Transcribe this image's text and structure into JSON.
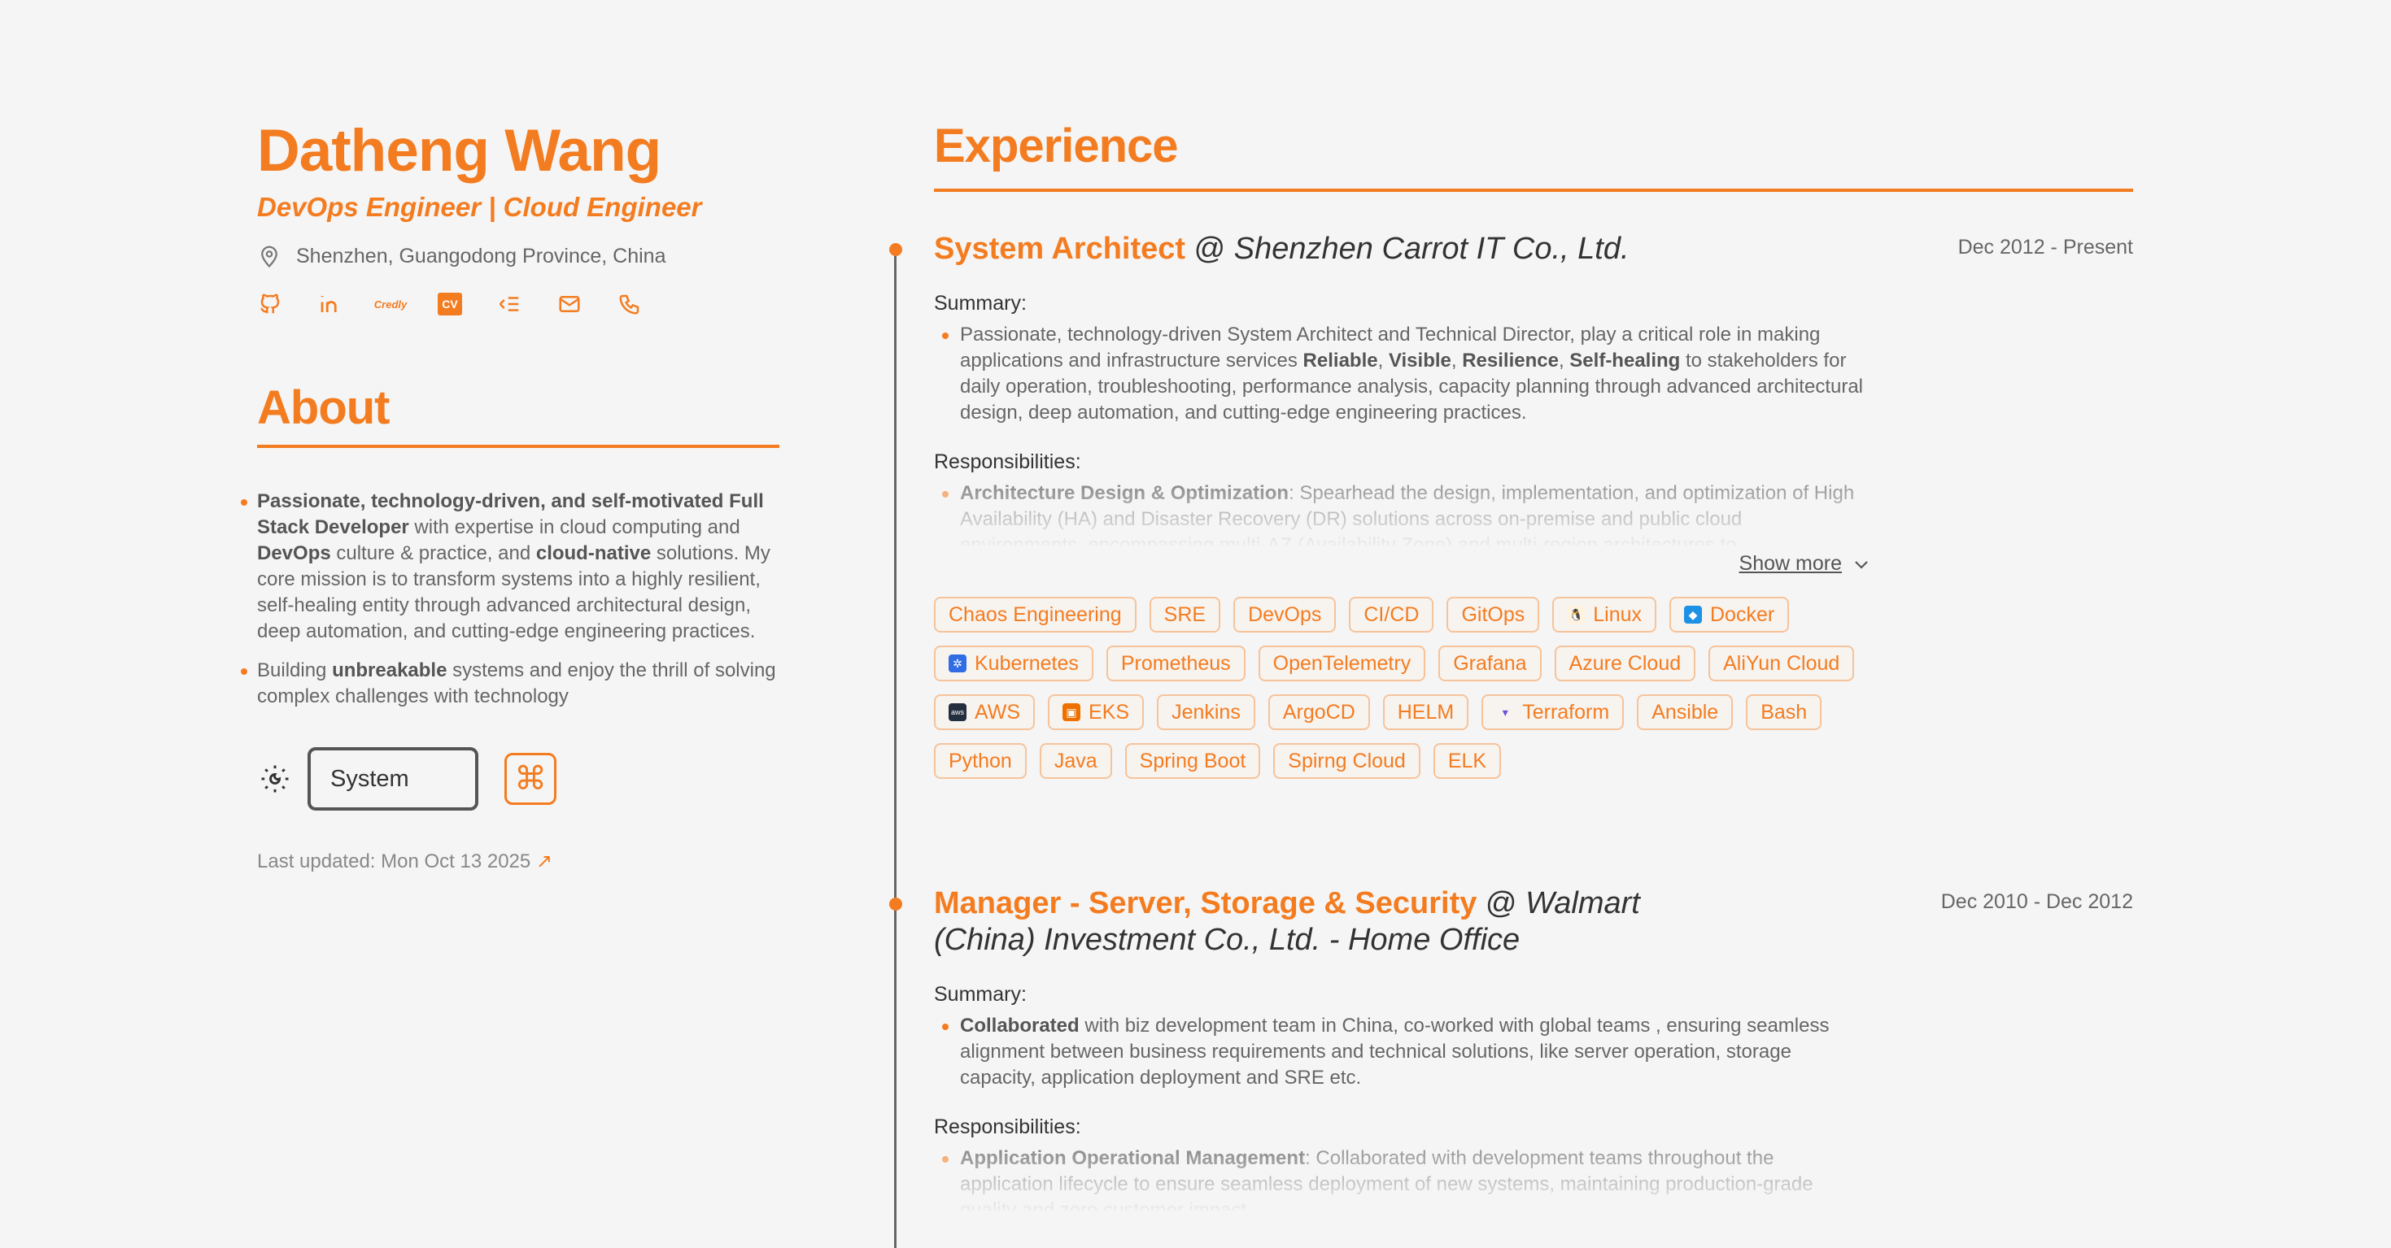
{
  "profile": {
    "name": "Datheng Wang",
    "role": "DevOps Engineer | Cloud Engineer",
    "location": "Shenzhen, Guangodong Province, China",
    "socials": [
      {
        "icon": "github-icon"
      },
      {
        "icon": "linkedin-icon"
      },
      {
        "icon": "credly-icon",
        "text": "Credly"
      },
      {
        "icon": "cv-icon",
        "text": "CV"
      },
      {
        "icon": "list-icon"
      },
      {
        "icon": "mail-icon"
      },
      {
        "icon": "phone-icon"
      }
    ]
  },
  "about": {
    "title": "About",
    "item1_bold1": "Passionate, technology-driven, and self-motivated Full Stack Developer",
    "item1_t1": " with expertise in cloud computing and ",
    "item1_bold2": "DevOps",
    "item1_t2": " culture & practice, and ",
    "item1_bold3": "cloud-native",
    "item1_t3": " solutions. My core mission is to transform systems into a highly resilient, self-healing entity through advanced architectural design, deep automation, and cutting-edge engineering practices.",
    "item2_t1": "Building ",
    "item2_bold": "unbreakable",
    "item2_t2": " systems and enjoy the thrill of solving complex challenges with technology"
  },
  "settings": {
    "theme_value": "System",
    "cmd_symbol": "⌘",
    "last_updated": "Last updated: Mon Oct 13 2025",
    "arrow": "↗"
  },
  "experience": {
    "title": "Experience",
    "jobs": [
      {
        "position": "System Architect",
        "at": " @ ",
        "company": "Shenzhen Carrot IT Co., Ltd.",
        "date": "Dec 2012 - Present",
        "summary_label": "Summary:",
        "summary_t1": "Passionate, technology-driven System Architect and Technical Director, play a critical role in making applications and infrastructure services ",
        "summary_b1": "Reliable",
        "sep1": ", ",
        "summary_b2": "Visible",
        "sep2": ", ",
        "summary_b3": "Resilience",
        "sep3": ", ",
        "summary_b4": "Self-healing",
        "summary_t2": " to stakeholders for daily operation, troubleshooting, performance analysis, capacity planning through advanced architectural design, deep automation, and cutting-edge engineering practices.",
        "resp_label": "Responsibilities:",
        "resp_bold": "Architecture Design & Optimization",
        "resp_text": ": Spearhead the design, implementation, and optimization of High Availability (HA) and Disaster Recovery (DR) solutions across on-premise and public cloud environments, encompassing multi-AZ (Availability Zone) and multi-region architectures to",
        "show_more": "Show more",
        "tags": [
          {
            "label": "Chaos Engineering"
          },
          {
            "label": "SRE"
          },
          {
            "label": "DevOps"
          },
          {
            "label": "CI/CD"
          },
          {
            "label": "GitOps"
          },
          {
            "label": "Linux",
            "icon": "linux-icon"
          },
          {
            "label": "Docker",
            "icon": "docker-icon"
          },
          {
            "label": "Kubernetes",
            "icon": "kubernetes-icon"
          },
          {
            "label": "Prometheus"
          },
          {
            "label": "OpenTelemetry"
          },
          {
            "label": "Grafana"
          },
          {
            "label": "Azure Cloud"
          },
          {
            "label": "AliYun Cloud"
          },
          {
            "label": "AWS",
            "icon": "aws-icon"
          },
          {
            "label": "EKS",
            "icon": "eks-icon"
          },
          {
            "label": "Jenkins"
          },
          {
            "label": "ArgoCD"
          },
          {
            "label": "HELM"
          },
          {
            "label": "Terraform",
            "icon": "terraform-icon"
          },
          {
            "label": "Ansible"
          },
          {
            "label": "Bash"
          },
          {
            "label": "Python"
          },
          {
            "label": "Java"
          },
          {
            "label": "Spring Boot"
          },
          {
            "label": "Spirng Cloud"
          },
          {
            "label": "ELK"
          }
        ]
      },
      {
        "position": "Manager - Server, Storage & Security",
        "at": " @ ",
        "company": "Walmart (China) Investment Co., Ltd. - Home Office",
        "date": "Dec 2010 - Dec 2012",
        "summary_label": "Summary:",
        "summary_b1": "Collaborated",
        "summary_t1": " with biz development team in China, co-worked with global teams , ensuring seamless alignment between business requirements and technical solutions, like server operation, storage capacity, application deployment and SRE etc.",
        "resp_label": "Responsibilities:",
        "resp_bold": "Application Operational Management",
        "resp_text": ": Collaborated with development teams throughout the application lifecycle to ensure seamless deployment of new systems, maintaining production-grade quality and zero customer impact."
      }
    ]
  },
  "colors": {
    "accent": "#f47c20",
    "tag_border": "#f6c39a",
    "text": "#555555"
  }
}
